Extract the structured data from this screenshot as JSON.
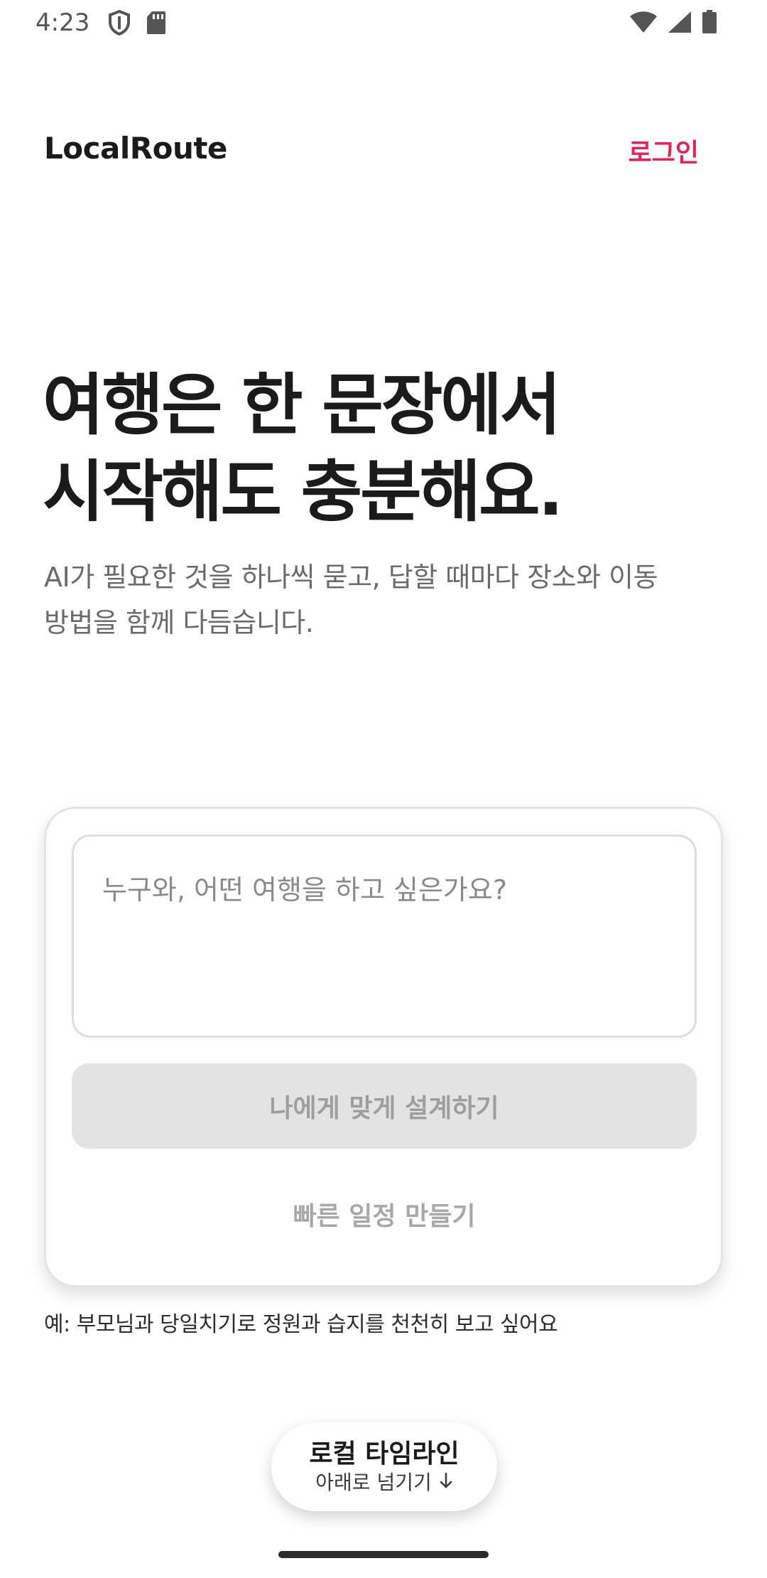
{
  "status_bar": {
    "time": "4:23",
    "icons": [
      "shield-icon",
      "sd-card-icon",
      "wifi-icon",
      "signal-icon",
      "battery-icon"
    ]
  },
  "header": {
    "app_title": "LocalRoute",
    "login_label": "로그인"
  },
  "hero": {
    "title_line1": "여행은 한 문장에서",
    "title_line2": "시작해도 충분해요.",
    "subtitle_line1": "AI가 필요한 것을 하나씩 묻고, 답할 때마다 장소와 이동",
    "subtitle_line2": "방법을 함께 다듬습니다."
  },
  "card": {
    "prompt_placeholder": "누구와, 어떤 여행을 하고 싶은가요?",
    "prompt_value": "",
    "design_button_label": "나에게 맞게 설계하기",
    "quick_button_label": "빠른 일정 만들기"
  },
  "example": {
    "text": "예: 부모님과 당일치기로 정원과 습지를 천천히 보고 싶어요"
  },
  "timeline_pill": {
    "title": "로컬 타임라인",
    "subtitle": "아래로 넘기기"
  },
  "colors": {
    "accent": "#e8235c",
    "disabled_button_bg": "#e3e3e3",
    "disabled_button_text": "#9e9e9e"
  }
}
